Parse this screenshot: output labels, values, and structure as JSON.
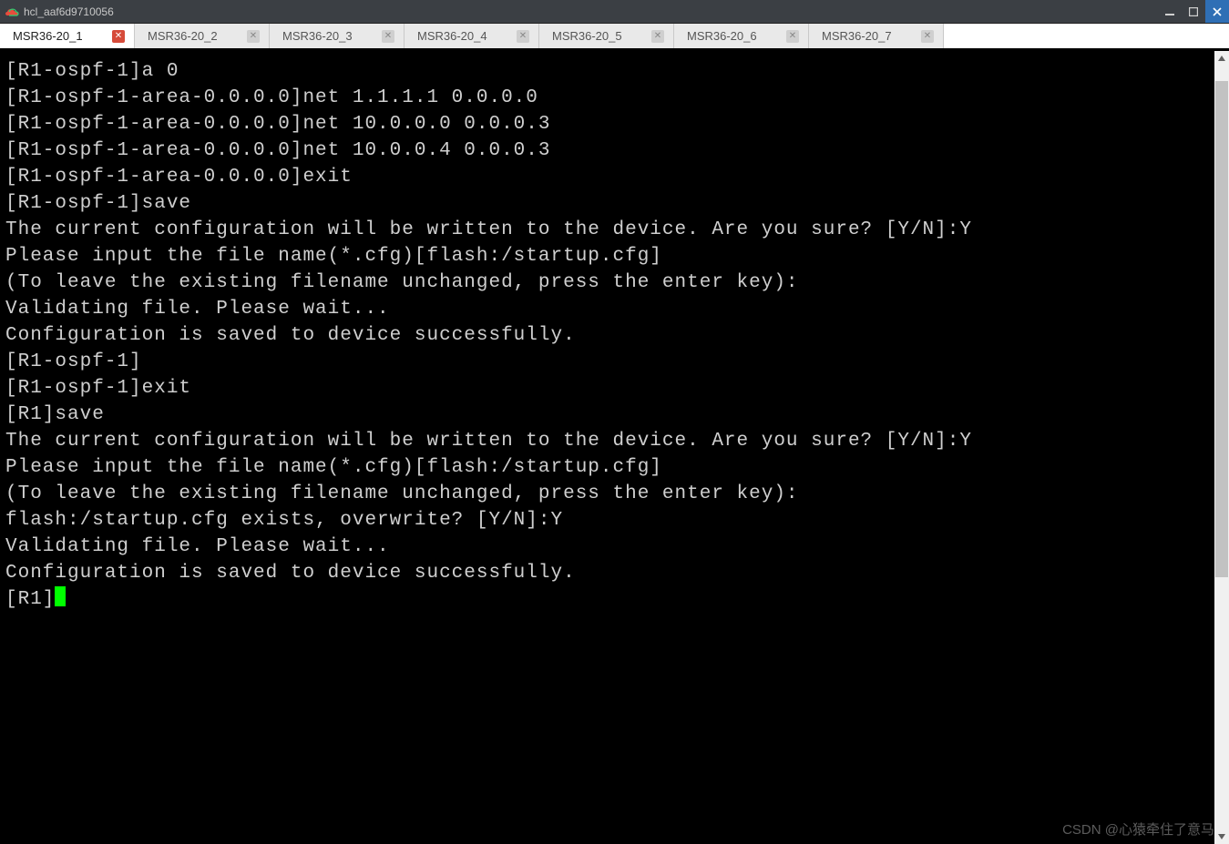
{
  "window": {
    "title": "hcl_aaf6d9710056"
  },
  "tabs": [
    {
      "label": "MSR36-20_1",
      "active": true
    },
    {
      "label": "MSR36-20_2",
      "active": false
    },
    {
      "label": "MSR36-20_3",
      "active": false
    },
    {
      "label": "MSR36-20_4",
      "active": false
    },
    {
      "label": "MSR36-20_5",
      "active": false
    },
    {
      "label": "MSR36-20_6",
      "active": false
    },
    {
      "label": "MSR36-20_7",
      "active": false
    }
  ],
  "terminal": {
    "lines": [
      "[R1-ospf-1]a 0",
      "[R1-ospf-1-area-0.0.0.0]net 1.1.1.1 0.0.0.0",
      "[R1-ospf-1-area-0.0.0.0]net 10.0.0.0 0.0.0.3",
      "[R1-ospf-1-area-0.0.0.0]net 10.0.0.4 0.0.0.3",
      "[R1-ospf-1-area-0.0.0.0]exit",
      "[R1-ospf-1]save",
      "The current configuration will be written to the device. Are you sure? [Y/N]:Y",
      "Please input the file name(*.cfg)[flash:/startup.cfg]",
      "(To leave the existing filename unchanged, press the enter key):",
      "Validating file. Please wait...",
      "Configuration is saved to device successfully.",
      "[R1-ospf-1]",
      "[R1-ospf-1]exit",
      "[R1]save",
      "The current configuration will be written to the device. Are you sure? [Y/N]:Y",
      "Please input the file name(*.cfg)[flash:/startup.cfg]",
      "(To leave the existing filename unchanged, press the enter key):",
      "flash:/startup.cfg exists, overwrite? [Y/N]:Y",
      "Validating file. Please wait...",
      "Configuration is saved to device successfully.",
      "[R1]"
    ],
    "wrap_width": 88
  },
  "scrollbar": {
    "thumb_top_pct": 2,
    "thumb_height_pct": 65
  },
  "watermark": "CSDN @心猿牵住了意马"
}
